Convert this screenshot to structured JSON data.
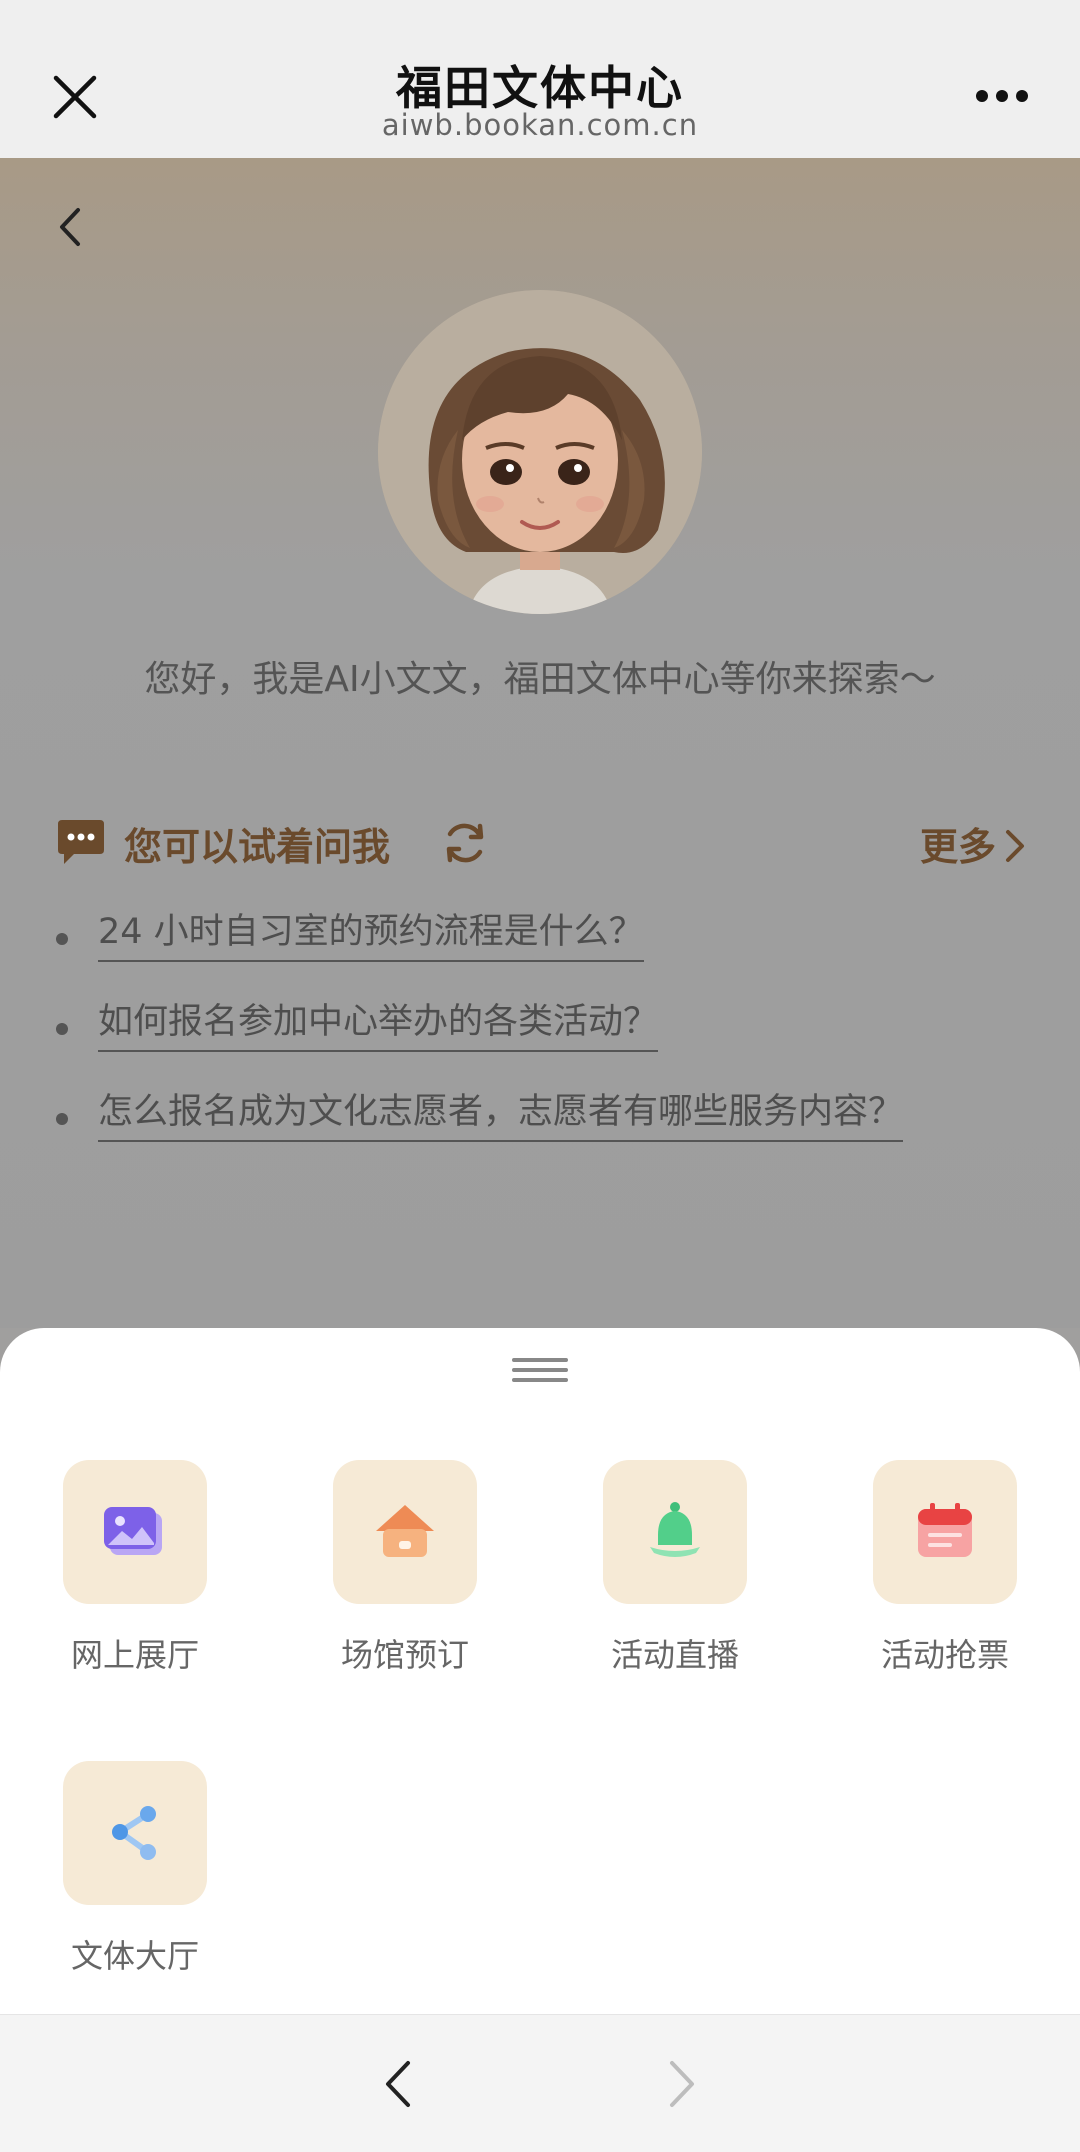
{
  "topbar": {
    "title": "福田文体中心",
    "subtitle": "aiwb.bookan.com.cn"
  },
  "main": {
    "greeting": "您好，我是AI小文文，福田文体中心等你来探索～",
    "suggest_title": "您可以试着问我",
    "more_label": "更多",
    "questions": [
      "24 小时自习室的预约流程是什么？",
      "如何报名参加中心举办的各类活动？",
      "怎么报名成为文化志愿者，志愿者有哪些服务内容？"
    ]
  },
  "sheet": {
    "items": [
      {
        "label": "网上展厅",
        "icon": "gallery-icon"
      },
      {
        "label": "场馆预订",
        "icon": "house-icon"
      },
      {
        "label": "活动直播",
        "icon": "bell-icon"
      },
      {
        "label": "活动抢票",
        "icon": "calendar-icon"
      },
      {
        "label": "文体大厅",
        "icon": "share-icon"
      }
    ]
  },
  "colors": {
    "accent_brown": "#6a4a2c",
    "tile_bg": "#f6ead6"
  }
}
